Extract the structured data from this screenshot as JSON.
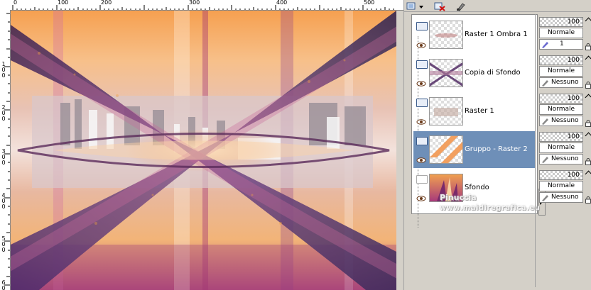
{
  "ruler": {
    "top_labels": [
      "0",
      "100",
      "200",
      "300",
      "400",
      "500"
    ],
    "left_labels": [
      "1\n0\n0",
      "2\n0\n0",
      "3\n0\n0",
      "4\n0\n0",
      "5\n0\n0",
      "6\n0\n0"
    ]
  },
  "toolbar": {
    "icons": [
      "new-layer-icon",
      "dropdown-arrow-icon",
      "delete-layer-icon",
      "edit-mask-icon"
    ]
  },
  "layers": [
    {
      "name": "Raster 1 Ombra 1",
      "selected": false,
      "opacity": "100",
      "blend": "Normale",
      "mask": "1"
    },
    {
      "name": "Copia di Sfondo",
      "selected": false,
      "opacity": "100",
      "blend": "Normale",
      "mask": "Nessuno"
    },
    {
      "name": "Raster 1",
      "selected": false,
      "opacity": "100",
      "blend": "Normale",
      "mask": "Nessuno"
    },
    {
      "name": "Gruppo - Raster 2",
      "selected": true,
      "opacity": "100",
      "blend": "Normale",
      "mask": "Nessuno"
    },
    {
      "name": "Sfondo",
      "selected": false,
      "opacity": "100",
      "blend": "Normale",
      "mask": "Nessuno"
    }
  ],
  "watermark": {
    "line1": "Pinuccia",
    "line2": "www.maidiregrafica.eu"
  },
  "colors": {
    "selection": "#6e8fb8",
    "panel_bg": "#d4d0c8",
    "canvas_orange": "#f2a45a",
    "canvas_purple": "#5a2a6a"
  }
}
